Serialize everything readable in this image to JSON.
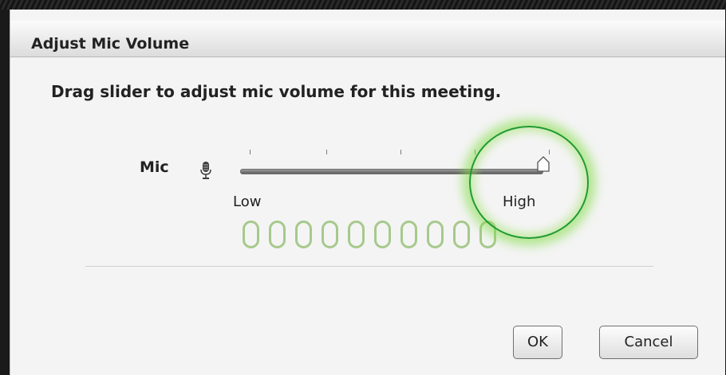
{
  "dialog": {
    "title": "Adjust Mic Volume",
    "instruction": "Drag slider to adjust mic volume for this meeting."
  },
  "mic": {
    "label": "Mic",
    "icon": "microphone-icon",
    "slider": {
      "min_label": "Low",
      "max_label": "High",
      "value_fraction": 1.0,
      "tick_count": 5
    },
    "meter": {
      "segment_count": 10,
      "active_segments": 0,
      "color": "#a6c98c"
    }
  },
  "annotation": {
    "highlight_color": "#1f9a2f",
    "glow_color": "#8fdc4b"
  },
  "buttons": {
    "ok_label": "OK",
    "cancel_label": "Cancel"
  }
}
